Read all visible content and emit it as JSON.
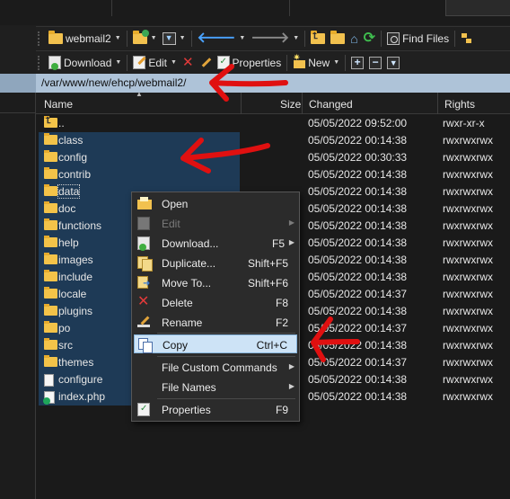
{
  "toolbar1": {
    "folder_name": "webmail2",
    "find_files_label": "Find Files"
  },
  "toolbar2": {
    "download_label": "Download",
    "edit_label": "Edit",
    "properties_label": "Properties",
    "new_label": "New"
  },
  "path": "/var/www/new/ehcp/webmail2/",
  "columns": {
    "name": "Name",
    "size": "Size",
    "changed": "Changed",
    "rights": "Rights"
  },
  "files": [
    {
      "name": "..",
      "kind": "parent",
      "changed": "05/05/2022 09:52:00",
      "rights": "rwxr-xr-x",
      "selected": false
    },
    {
      "name": "class",
      "kind": "folder",
      "changed": "05/05/2022 00:14:38",
      "rights": "rwxrwxrwx",
      "selected": true
    },
    {
      "name": "config",
      "kind": "folder",
      "changed": "05/05/2022 00:30:33",
      "rights": "rwxrwxrwx",
      "selected": true
    },
    {
      "name": "contrib",
      "kind": "folder",
      "changed": "05/05/2022 00:14:38",
      "rights": "rwxrwxrwx",
      "selected": true
    },
    {
      "name": "data",
      "kind": "folder",
      "changed": "05/05/2022 00:14:38",
      "rights": "rwxrwxrwx",
      "selected": true,
      "focused": true
    },
    {
      "name": "doc",
      "kind": "folder",
      "changed": "05/05/2022 00:14:38",
      "rights": "rwxrwxrwx",
      "selected": true
    },
    {
      "name": "functions",
      "kind": "folder",
      "changed": "05/05/2022 00:14:38",
      "rights": "rwxrwxrwx",
      "selected": true
    },
    {
      "name": "help",
      "kind": "folder",
      "changed": "05/05/2022 00:14:38",
      "rights": "rwxrwxrwx",
      "selected": true
    },
    {
      "name": "images",
      "kind": "folder",
      "changed": "05/05/2022 00:14:38",
      "rights": "rwxrwxrwx",
      "selected": true
    },
    {
      "name": "include",
      "kind": "folder",
      "changed": "05/05/2022 00:14:38",
      "rights": "rwxrwxrwx",
      "selected": true
    },
    {
      "name": "locale",
      "kind": "folder",
      "changed": "05/05/2022 00:14:37",
      "rights": "rwxrwxrwx",
      "selected": true
    },
    {
      "name": "plugins",
      "kind": "folder",
      "changed": "05/05/2022 00:14:38",
      "rights": "rwxrwxrwx",
      "selected": true
    },
    {
      "name": "po",
      "kind": "folder",
      "changed": "05/05/2022 00:14:37",
      "rights": "rwxrwxrwx",
      "selected": true
    },
    {
      "name": "src",
      "kind": "folder",
      "changed": "05/05/2022 00:14:38",
      "rights": "rwxrwxrwx",
      "selected": true
    },
    {
      "name": "themes",
      "kind": "folder",
      "changed": "05/05/2022 00:14:37",
      "rights": "rwxrwxrwx",
      "selected": true
    },
    {
      "name": "configure",
      "kind": "file",
      "changed": "05/05/2022 00:14:38",
      "rights": "rwxrwxrwx",
      "selected": true
    },
    {
      "name": "index.php",
      "kind": "php",
      "changed": "05/05/2022 00:14:38",
      "rights": "rwxrwxrwx",
      "selected": true
    }
  ],
  "context_menu": [
    {
      "label": "Open",
      "icon": "open-icon",
      "shortcut": "",
      "submenu": false,
      "disabled": false
    },
    {
      "label": "Edit",
      "icon": "edit-icon",
      "shortcut": "",
      "submenu": true,
      "disabled": true
    },
    {
      "label": "Download...",
      "icon": "download-icon",
      "shortcut": "F5",
      "submenu": true,
      "disabled": false
    },
    {
      "label": "Duplicate...",
      "icon": "duplicate-icon",
      "shortcut": "Shift+F5",
      "submenu": false,
      "disabled": false
    },
    {
      "label": "Move To...",
      "icon": "move-icon",
      "shortcut": "Shift+F6",
      "submenu": false,
      "disabled": false
    },
    {
      "label": "Delete",
      "icon": "delete-icon",
      "shortcut": "F8",
      "submenu": false,
      "disabled": false
    },
    {
      "label": "Rename",
      "icon": "rename-icon",
      "shortcut": "F2",
      "submenu": false,
      "disabled": false
    },
    {
      "label": "Copy",
      "icon": "copy-icon",
      "shortcut": "Ctrl+C",
      "submenu": false,
      "disabled": false,
      "highlighted": true
    },
    {
      "label": "File Custom Commands",
      "icon": "",
      "shortcut": "",
      "submenu": true,
      "disabled": false
    },
    {
      "label": "File Names",
      "icon": "",
      "shortcut": "",
      "submenu": true,
      "disabled": false
    },
    {
      "label": "Properties",
      "icon": "properties-icon",
      "shortcut": "F9",
      "submenu": false,
      "disabled": false
    }
  ],
  "colors": {
    "selection": "#1e3a56",
    "path_bar": "#aec3d8",
    "menu_highlight": "#cde3f6",
    "annotation_arrow": "#e01010"
  }
}
